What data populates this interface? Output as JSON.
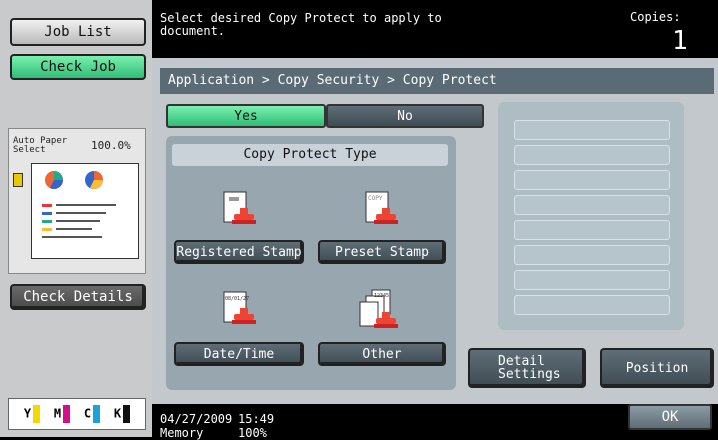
{
  "left": {
    "job_list": "Job List",
    "check_job": "Check Job",
    "paper": "Auto Paper\nSelect",
    "zoom": "100.0%",
    "check_details": "Check Details",
    "toner": [
      {
        "label": "Y",
        "color": "#f5d800"
      },
      {
        "label": "M",
        "color": "#d0108c"
      },
      {
        "label": "C",
        "color": "#1aa3d8"
      },
      {
        "label": "K",
        "color": "#111111"
      }
    ]
  },
  "header": {
    "message": "Select desired Copy Protect to apply to\ndocument.",
    "copies_label": "Copies:",
    "copies_value": "1"
  },
  "breadcrumb": "Application > Copy Security > Copy Protect",
  "toggle": {
    "yes": "Yes",
    "no": "No"
  },
  "type_panel": {
    "title": "Copy Protect Type",
    "registered_stamp": "Registered Stamp",
    "preset_stamp": "Preset Stamp",
    "date_time": "Date/Time",
    "other": "Other"
  },
  "actions": {
    "detail_settings": "Detail\nSettings",
    "position": "Position",
    "ok": "OK"
  },
  "footer": {
    "date": "04/27/2009",
    "time": "15:49",
    "memory_label": "Memory",
    "memory_value": "100%"
  },
  "colors": {
    "accent_green": "#2fbd76",
    "panel": "#98a6b0"
  }
}
